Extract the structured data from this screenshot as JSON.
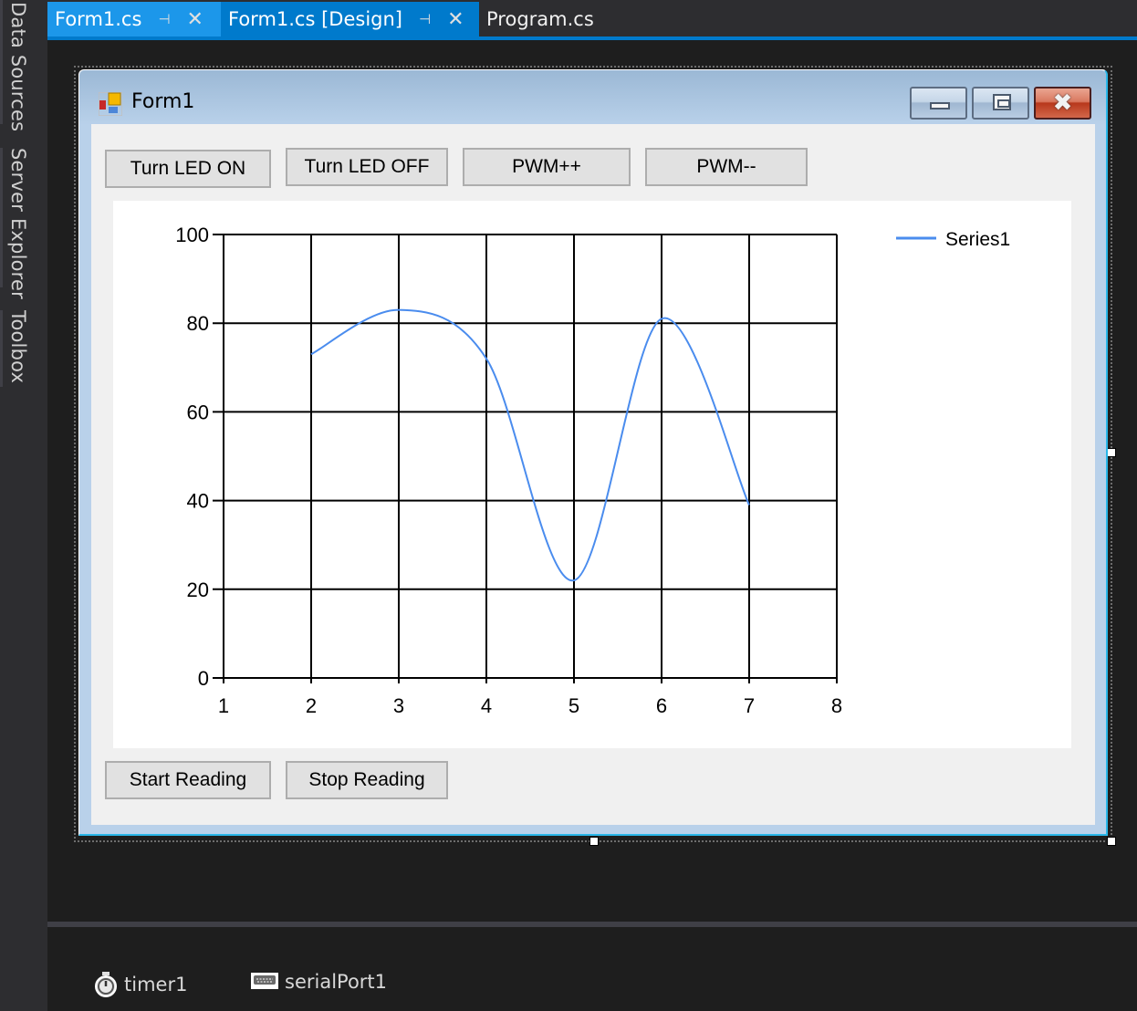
{
  "side_rail": {
    "items": [
      {
        "label": "Data Sources"
      },
      {
        "label": "Server Explorer"
      },
      {
        "label": "Toolbox"
      }
    ]
  },
  "tabs": [
    {
      "label": "Form1.cs",
      "pinned_icon": "pin-icon",
      "close_icon": "close-icon",
      "state": "open"
    },
    {
      "label": "Form1.cs [Design]",
      "pinned_icon": "pin-icon",
      "close_icon": "close-icon",
      "state": "active"
    },
    {
      "label": "Program.cs",
      "state": "inactive"
    }
  ],
  "form": {
    "title": "Form1",
    "icon": "form-icon",
    "window_buttons": {
      "minimize": "minimize-icon",
      "maximize": "maximize-icon",
      "close": "close-icon"
    },
    "top_buttons": [
      {
        "label": "Turn LED ON"
      },
      {
        "label": "Turn LED OFF"
      },
      {
        "label": "PWM++"
      },
      {
        "label": "PWM--"
      }
    ],
    "bottom_buttons": [
      {
        "label": "Start Reading"
      },
      {
        "label": "Stop Reading"
      }
    ],
    "series_color": "#4a8cee"
  },
  "chart_data": {
    "type": "line",
    "smooth": true,
    "title": "",
    "xlabel": "",
    "ylabel": "",
    "xlim": [
      1,
      8
    ],
    "ylim": [
      0,
      100
    ],
    "x_ticks": [
      "1",
      "2",
      "3",
      "4",
      "5",
      "6",
      "7",
      "8"
    ],
    "y_ticks": [
      "0",
      "20",
      "40",
      "60",
      "80",
      "100"
    ],
    "grid": true,
    "legend_position": "top-right",
    "series": [
      {
        "name": "Series1",
        "x": [
          2,
          3,
          4,
          5,
          6,
          7
        ],
        "values": [
          73,
          83,
          72,
          22,
          81,
          39
        ]
      }
    ]
  },
  "component_tray": {
    "items": [
      {
        "label": "timer1",
        "icon": "timer-icon"
      },
      {
        "label": "serialPort1",
        "icon": "serial-port-icon"
      }
    ]
  }
}
